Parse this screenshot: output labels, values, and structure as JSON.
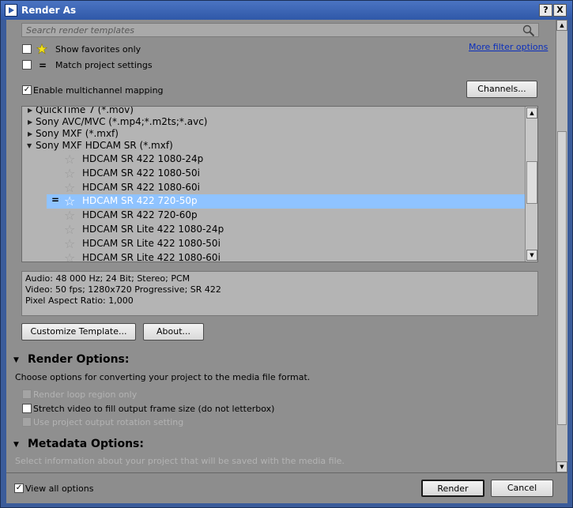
{
  "window": {
    "title": "Render As",
    "help_label": "?",
    "close_label": "X"
  },
  "search": {
    "placeholder": "Search render templates"
  },
  "filters": {
    "show_favorites": {
      "label": "Show favorites only",
      "checked": false
    },
    "match_project": {
      "label": "Match project settings",
      "checked": false
    },
    "more_filter_link": "More filter options"
  },
  "multichannel": {
    "label": "Enable multichannel mapping",
    "checked": true,
    "channels_button": "Channels..."
  },
  "templates": {
    "rows": [
      {
        "kind": "format",
        "label": "QuickTime 7 (*.mov)",
        "expanded": false
      },
      {
        "kind": "format",
        "label": "Sony AVC/MVC (*.mp4;*.m2ts;*.avc)",
        "expanded": false
      },
      {
        "kind": "format",
        "label": "Sony MXF (*.mxf)",
        "expanded": false
      },
      {
        "kind": "format",
        "label": "Sony MXF HDCAM SR (*.mxf)",
        "expanded": true
      },
      {
        "kind": "template",
        "label": "HDCAM SR 422 1080-24p"
      },
      {
        "kind": "template",
        "label": "HDCAM SR 422 1080-50i"
      },
      {
        "kind": "template",
        "label": "HDCAM SR 422 1080-60i"
      },
      {
        "kind": "template",
        "label": "HDCAM SR 422 720-50p",
        "selected": true,
        "match_marker": "="
      },
      {
        "kind": "template",
        "label": "HDCAM SR 422 720-60p"
      },
      {
        "kind": "template",
        "label": "HDCAM SR Lite 422 1080-24p"
      },
      {
        "kind": "template",
        "label": "HDCAM SR Lite 422 1080-50i"
      },
      {
        "kind": "template",
        "label": "HDCAM SR Lite 422 1080-60i"
      }
    ]
  },
  "info": {
    "audio": "Audio: 48 000 Hz; 24 Bit; Stereo; PCM",
    "video": "Video: 50 fps; 1280x720 Progressive; SR 422",
    "par": "Pixel Aspect Ratio: 1,000"
  },
  "buttons": {
    "customize": "Customize Template...",
    "about": "About...",
    "render": "Render",
    "cancel": "Cancel"
  },
  "render_options": {
    "title": "Render Options:",
    "description": "Choose options for converting your project to the media file format.",
    "loop_region": {
      "label": "Render loop region only",
      "enabled": false,
      "checked": false
    },
    "stretch_video": {
      "label": "Stretch video to fill output frame size (do not letterbox)",
      "enabled": true,
      "checked": false
    },
    "rotation": {
      "label": "Use project output rotation setting",
      "enabled": false,
      "checked": false
    }
  },
  "metadata_options": {
    "title": "Metadata Options:",
    "description": "Select information about your project that will be saved with the media file."
  },
  "footer": {
    "view_all": {
      "label": "View all options",
      "checked": true
    }
  },
  "icons": {
    "star": "star-icon",
    "search": "search-icon",
    "expand": "expand-icon",
    "collapse": "collapse-icon"
  },
  "colors": {
    "selection": "#8fc3ff",
    "title_bar": "#2f58a8",
    "link": "#0b2fbd"
  }
}
